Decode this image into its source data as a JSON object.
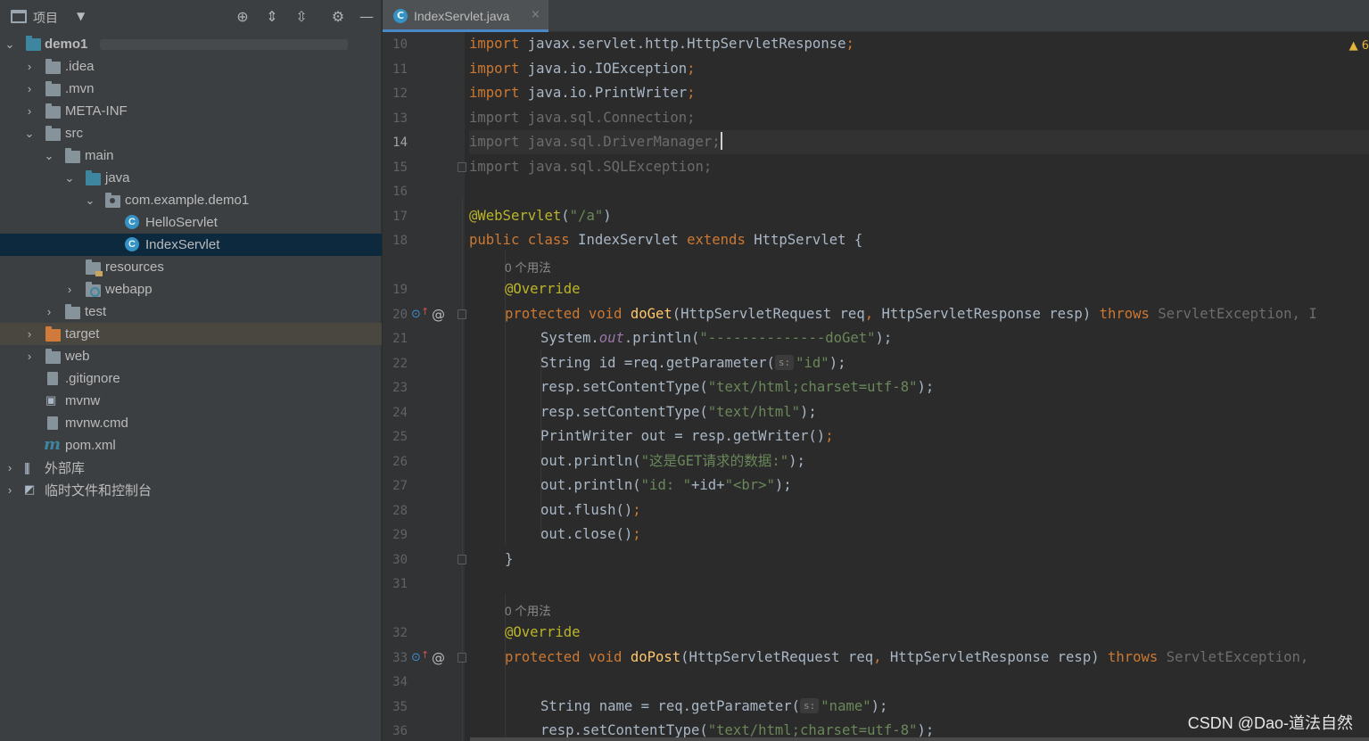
{
  "panel": {
    "title": "项目",
    "dropdown": "▼",
    "tools": [
      "locate-icon",
      "expand-all-icon",
      "collapse-all-icon",
      "gear-icon",
      "minimize-icon"
    ]
  },
  "tree": [
    {
      "label": "demo1",
      "depth": 0,
      "expanded": true,
      "icon": "module-folder",
      "bold": true
    },
    {
      "label": ".idea",
      "depth": 1,
      "expanded": false,
      "icon": "folder"
    },
    {
      "label": ".mvn",
      "depth": 1,
      "expanded": false,
      "icon": "folder"
    },
    {
      "label": "META-INF",
      "depth": 1,
      "expanded": false,
      "icon": "folder"
    },
    {
      "label": "src",
      "depth": 1,
      "expanded": true,
      "icon": "folder"
    },
    {
      "label": "main",
      "depth": 2,
      "expanded": true,
      "icon": "folder"
    },
    {
      "label": "java",
      "depth": 3,
      "expanded": true,
      "icon": "source-folder"
    },
    {
      "label": "com.example.demo1",
      "depth": 4,
      "expanded": true,
      "icon": "package"
    },
    {
      "label": "HelloServlet",
      "depth": 5,
      "icon": "class"
    },
    {
      "label": "IndexServlet",
      "depth": 5,
      "icon": "class",
      "selected": true
    },
    {
      "label": "resources",
      "depth": 3,
      "icon": "resources-folder"
    },
    {
      "label": "webapp",
      "depth": 3,
      "expanded": false,
      "icon": "web-folder"
    },
    {
      "label": "test",
      "depth": 2,
      "expanded": false,
      "icon": "folder"
    },
    {
      "label": "target",
      "depth": 1,
      "expanded": false,
      "icon": "excluded-folder",
      "excluded": true
    },
    {
      "label": "web",
      "depth": 1,
      "expanded": false,
      "icon": "folder"
    },
    {
      "label": ".gitignore",
      "depth": 1,
      "icon": "ignore-file"
    },
    {
      "label": "mvnw",
      "depth": 1,
      "icon": "script-file"
    },
    {
      "label": "mvnw.cmd",
      "depth": 1,
      "icon": "text-file"
    },
    {
      "label": "pom.xml",
      "depth": 1,
      "icon": "maven-file"
    },
    {
      "label": "外部库",
      "depth": 0,
      "expanded": false,
      "icon": "library"
    },
    {
      "label": "临时文件和控制台",
      "depth": 0,
      "expanded": false,
      "icon": "scratch"
    }
  ],
  "editor": {
    "tab": {
      "label": "IndexServlet.java",
      "close": "×"
    },
    "warning": "▲ 6",
    "usage_hint": "0 个用法",
    "param_hint": "s:",
    "watermark": "CSDN @Dao-道法自然",
    "current_line": "14",
    "line_numbers": [
      "10",
      "11",
      "12",
      "13",
      "14",
      "15",
      "16",
      "17",
      "18",
      "19",
      "20",
      "21",
      "22",
      "23",
      "24",
      "25",
      "26",
      "27",
      "28",
      "29",
      "30",
      "31",
      "32",
      "33",
      "34",
      "35",
      "36"
    ],
    "code": {
      "l10": [
        "import",
        " javax.servlet.http.HttpServletResponse",
        ";"
      ],
      "l11": [
        "import",
        " java.io.IOException",
        ";"
      ],
      "l12": [
        "import",
        " java.io.PrintWriter",
        ";"
      ],
      "l13": [
        "import java.sql.Connection;"
      ],
      "l14": [
        "import java.sql.DriverManager;"
      ],
      "l15": [
        "import java.sql.SQLException;"
      ],
      "l17": [
        "@WebServlet",
        "(",
        "\"/a\"",
        ")"
      ],
      "l18": [
        "public class",
        " IndexServlet ",
        "extends",
        " HttpServlet {"
      ],
      "l19": [
        "@Override"
      ],
      "l20": [
        "protected void",
        " ",
        "doGet",
        "(HttpServletRequest req",
        ",",
        " HttpServletResponse resp) ",
        "throws",
        " ServletException, I"
      ],
      "l21": [
        "System.",
        "out",
        ".println(",
        "\"--------------doGet\"",
        ");"
      ],
      "l22": [
        "String id =req.getParameter(",
        "\"id\"",
        ");"
      ],
      "l23": [
        "resp.setContentType(",
        "\"text/html;charset=utf-8\"",
        ");"
      ],
      "l24": [
        "resp.setContentType(",
        "\"text/html\"",
        ");"
      ],
      "l25": [
        "PrintWriter out = resp.getWriter()",
        ";"
      ],
      "l26": [
        "out.println(",
        "\"这是GET请求的数据:\"",
        ");"
      ],
      "l27": [
        "out.println(",
        "\"id: \"",
        "+id+",
        "\"<br>\"",
        ");"
      ],
      "l28": [
        "out.flush()",
        ";"
      ],
      "l29": [
        "out.close()",
        ";"
      ],
      "l30": [
        "}"
      ],
      "l32": [
        "@Override"
      ],
      "l33": [
        "protected void",
        " ",
        "doPost",
        "(HttpServletRequest req",
        ",",
        " HttpServletResponse resp) ",
        "throws",
        " ServletException,"
      ],
      "l35": [
        "String name = req.getParameter(",
        "\"name\"",
        ");"
      ],
      "l36": [
        "resp.setContentType(",
        "\"text/html;charset=utf-8\"",
        ");"
      ]
    }
  },
  "colors": {
    "keyword": "#cc7832",
    "annotation": "#bbb529",
    "string": "#6a8759",
    "method": "#ffc66d",
    "field": "#9876aa",
    "text": "#a9b7c6",
    "selection": "#0d293e"
  }
}
